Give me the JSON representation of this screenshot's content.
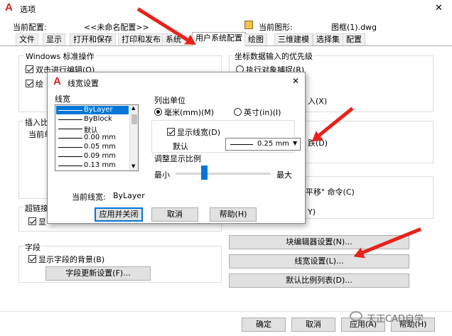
{
  "window": {
    "title": "选项",
    "current_profile_label": "当前配置:",
    "current_profile_value": "<<未命名配置>>",
    "current_drawing_label": "当前图形:",
    "current_drawing_value": "图框(1).dwg",
    "close": "✕"
  },
  "tabs": [
    "文件",
    "显示",
    "打开和保存",
    "打印和发布",
    "系统",
    "用户系统配置",
    "绘图",
    "三维建模",
    "选择集",
    "配置"
  ],
  "left": {
    "windows_group": "Windows 标准操作",
    "dblclick_edit": "双击进行编辑(O)",
    "partial_2": "绘",
    "insert_group_partial": "插入比",
    "current_unit_partial": "当前单",
    "hyperlink_partial": "超链接",
    "hyperlink_cb_partial": "显",
    "fields_group": "字段",
    "show_field_bg": "显示字段的背景(B)",
    "field_update_btn": "字段更新设置(F)..."
  },
  "right": {
    "coord_group": "坐标数据输入的优先级",
    "exec_osnap": "执行对象捕捉(R)",
    "partial_x": "入(X)",
    "partial_d": "跌(D)",
    "partial_pan": "平移\" 命令(C)",
    "partial_y": "Y)",
    "block_editor_btn": "块编辑器设置(N)...",
    "lineweight_btn": "线宽设置(L)...",
    "scale_list_btn": "默认比例列表(D)..."
  },
  "bottom": {
    "ok": "确定",
    "cancel": "取消",
    "apply": "应用(A)",
    "help": "帮助(H)"
  },
  "watermark": "天正CAD自学",
  "lw_dialog": {
    "title": "线宽设置",
    "close": "✕",
    "lineweights_label": "线宽",
    "lineweights": [
      "ByLayer",
      "ByBlock",
      "默认",
      "0.00 mm",
      "0.05 mm",
      "0.09 mm",
      "0.13 mm"
    ],
    "units_label": "列出单位",
    "unit_mm": "毫米(mm)(M)",
    "unit_in": "英寸(in)(I)",
    "show_lw": "显示线宽(D)",
    "default_label": "默认",
    "default_value": "0.25 mm",
    "scale_label": "调整显示比例",
    "scale_min": "最小",
    "scale_max": "最大",
    "scale_level": 0.3,
    "current_label": "当前线宽:",
    "current_value": "ByLayer",
    "apply_close": "应用并关闭",
    "cancel": "取消",
    "help": "帮助(H)"
  }
}
